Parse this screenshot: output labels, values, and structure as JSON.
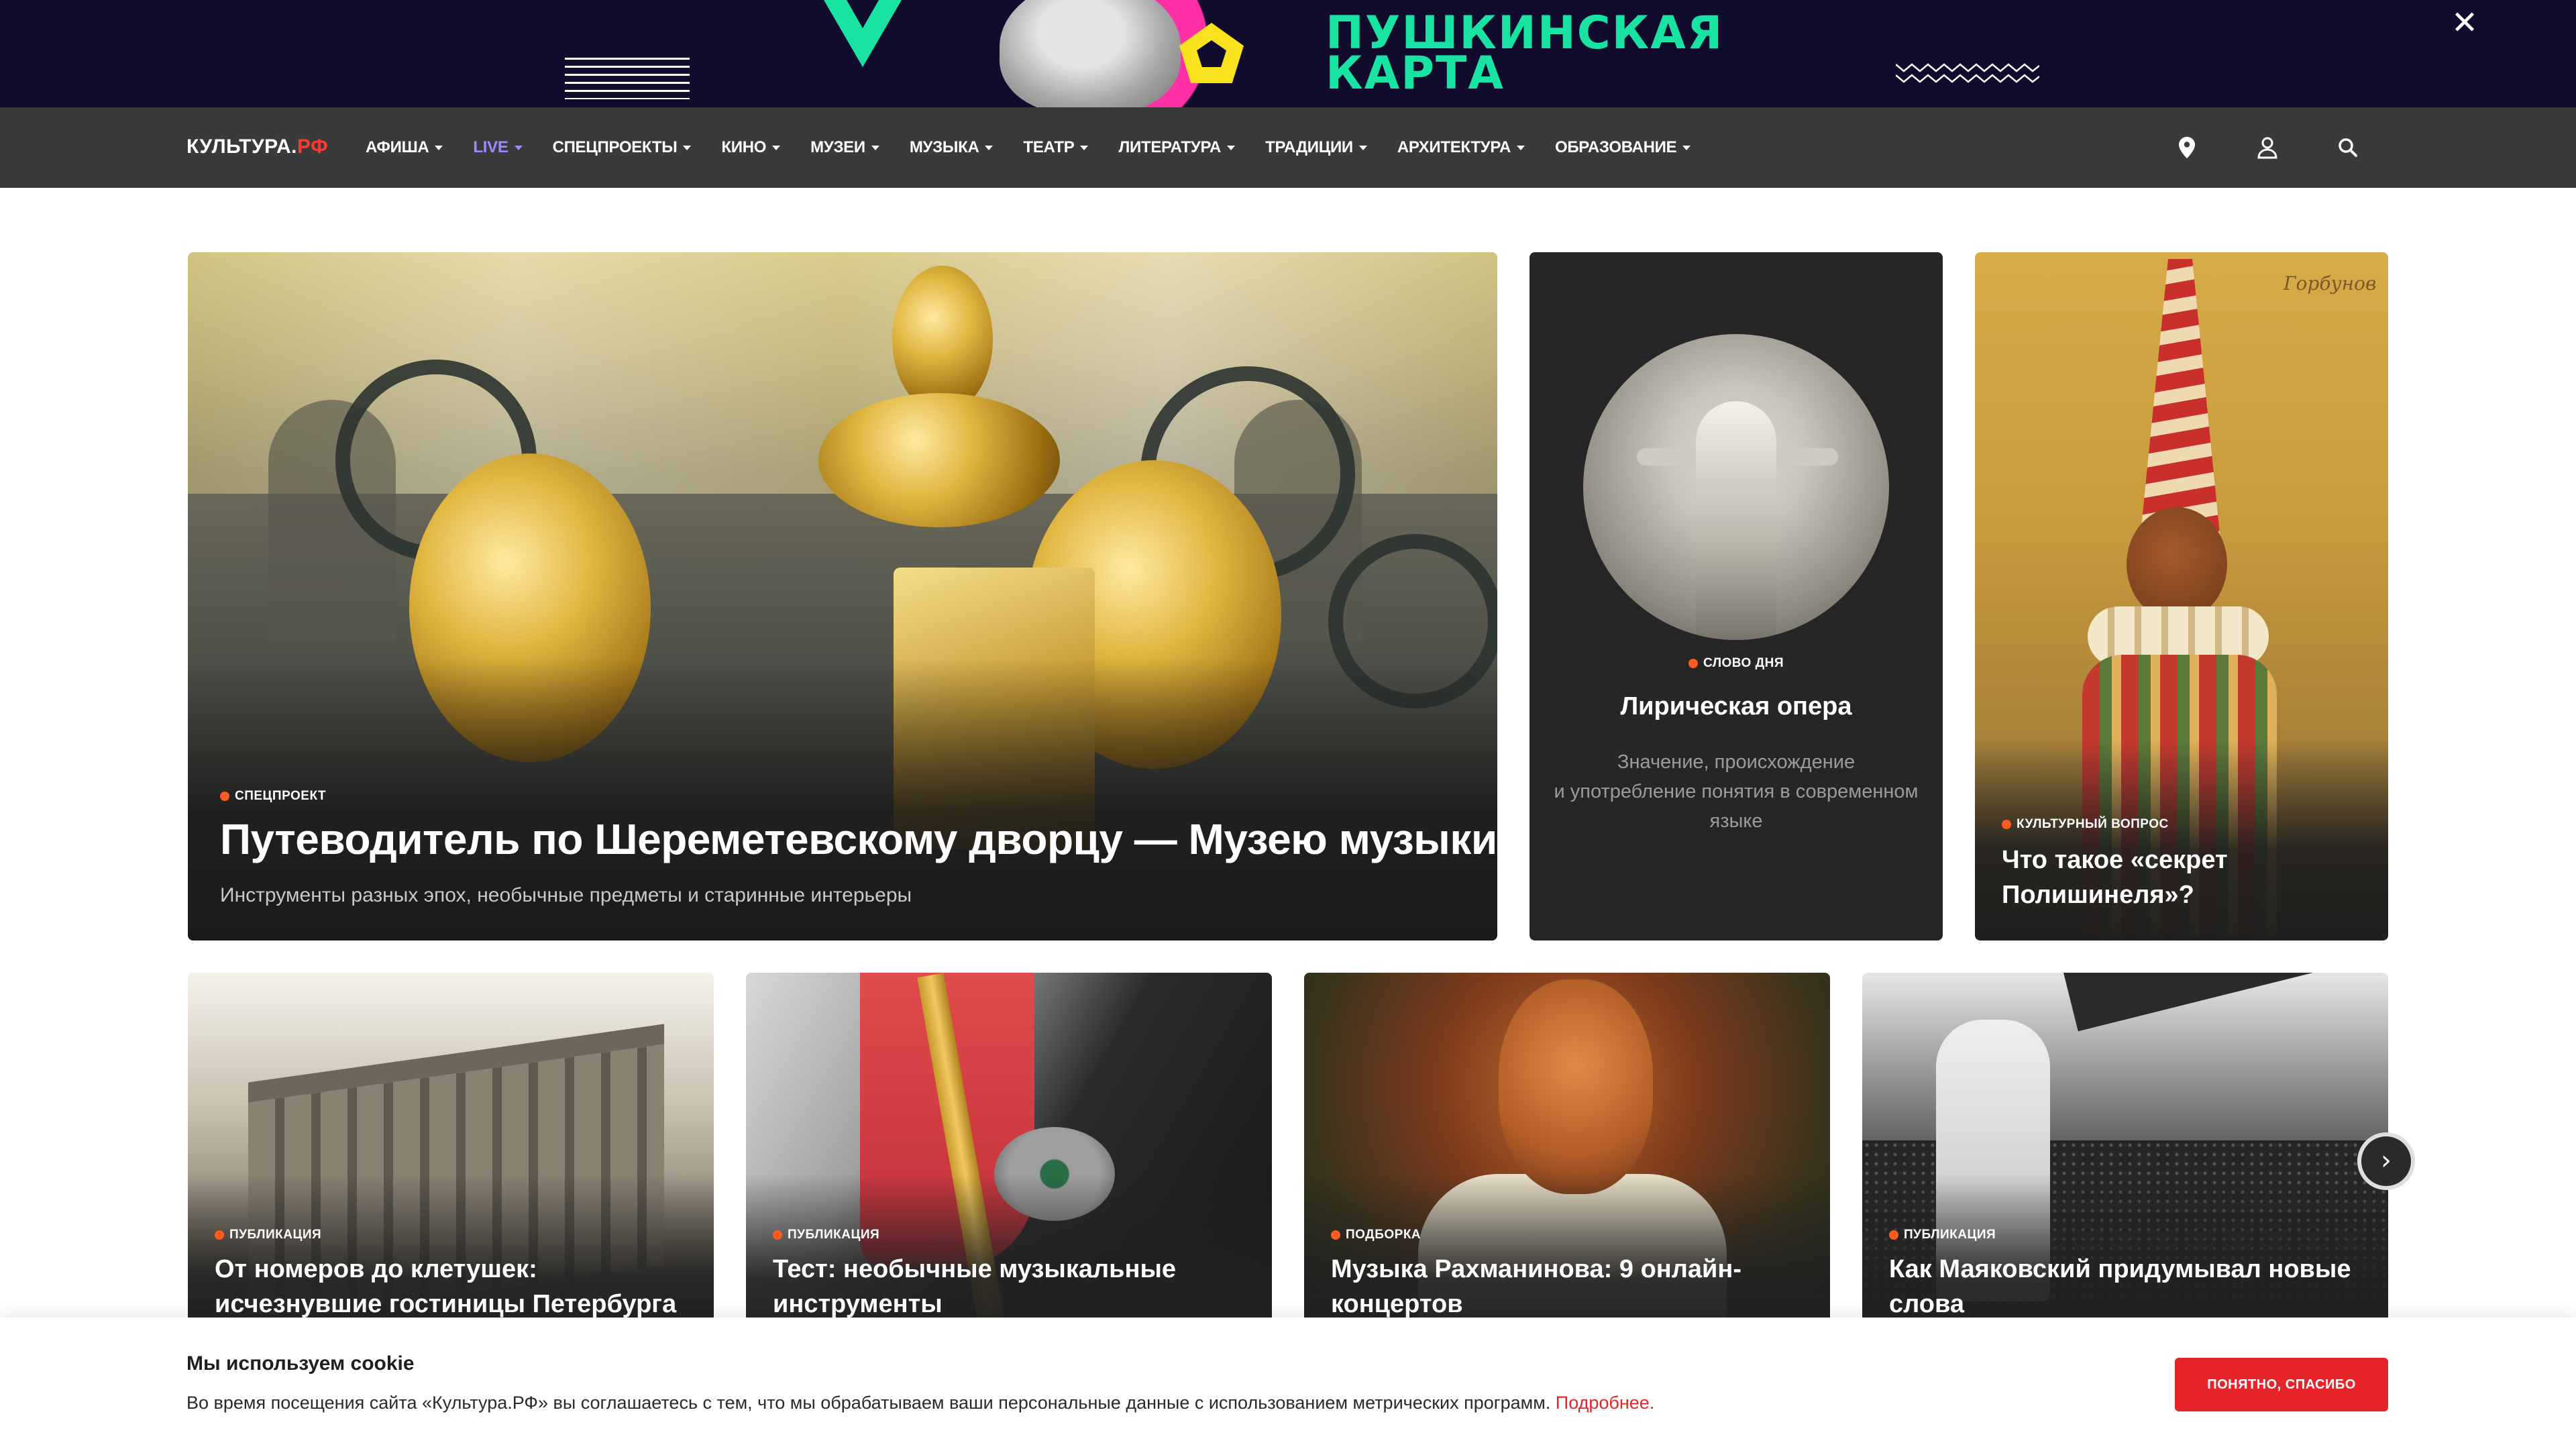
{
  "promo": {
    "title_line1": "Пушкинская",
    "title_line2": "карта",
    "close_icon": "close-icon"
  },
  "nav": {
    "logo_main": "КУЛЬТУРА.",
    "logo_accent": "РФ",
    "items": [
      "Афиша",
      "LIVE",
      "Спецпроекты",
      "Кино",
      "Музеи",
      "Музыка",
      "Театр",
      "Литература",
      "Традиции",
      "Архитектура",
      "Образование"
    ],
    "icons": [
      "map-pin-icon",
      "user-icon",
      "search-icon"
    ]
  },
  "hero": {
    "tag": "Спецпроект",
    "title": "Путеводитель по Шереметевскому дворцу — Музею музыки",
    "subtitle": "Инструменты разных эпох, необычные предметы и старинные интерьеры"
  },
  "word_of_day": {
    "tag": "Слово дня",
    "title": "Лирическая опера",
    "description_line1": "Значение, происхождение",
    "description_line2": "и употребление понятия в современном",
    "description_line3": "языке"
  },
  "culture_question": {
    "tag": "Культурный вопрос",
    "title": "Что такое «секрет Полишинеля»?"
  },
  "cards": [
    {
      "tag": "Публикация",
      "title": "От номеров до клетушек: исчезнувшие гостиницы Петербурга"
    },
    {
      "tag": "Публикация",
      "title": "Тест: необычные музыкальные инструменты"
    },
    {
      "tag": "Подборка",
      "title": "Музыка Рахманинова: 9 онлайн-концертов"
    },
    {
      "tag": "Публикация",
      "title": "Как Маяковский придумывал новые слова"
    }
  ],
  "cookie": {
    "title": "Мы используем cookie",
    "text": "Во время посещения сайта «Культура.РФ» вы соглашаетесь с тем, что мы обрабатываем ваши персональные данные с использованием метрических программ. ",
    "link": "Подробнее.",
    "button": "Понятно, спасибо"
  },
  "colors": {
    "nav_bg": "#3a3a3a",
    "accent_red": "#e8242b",
    "tag_dot": "#ff5a1f",
    "live": "#9a8cff",
    "promo_bg": "#110b2e",
    "promo_green": "#19e3a3"
  }
}
